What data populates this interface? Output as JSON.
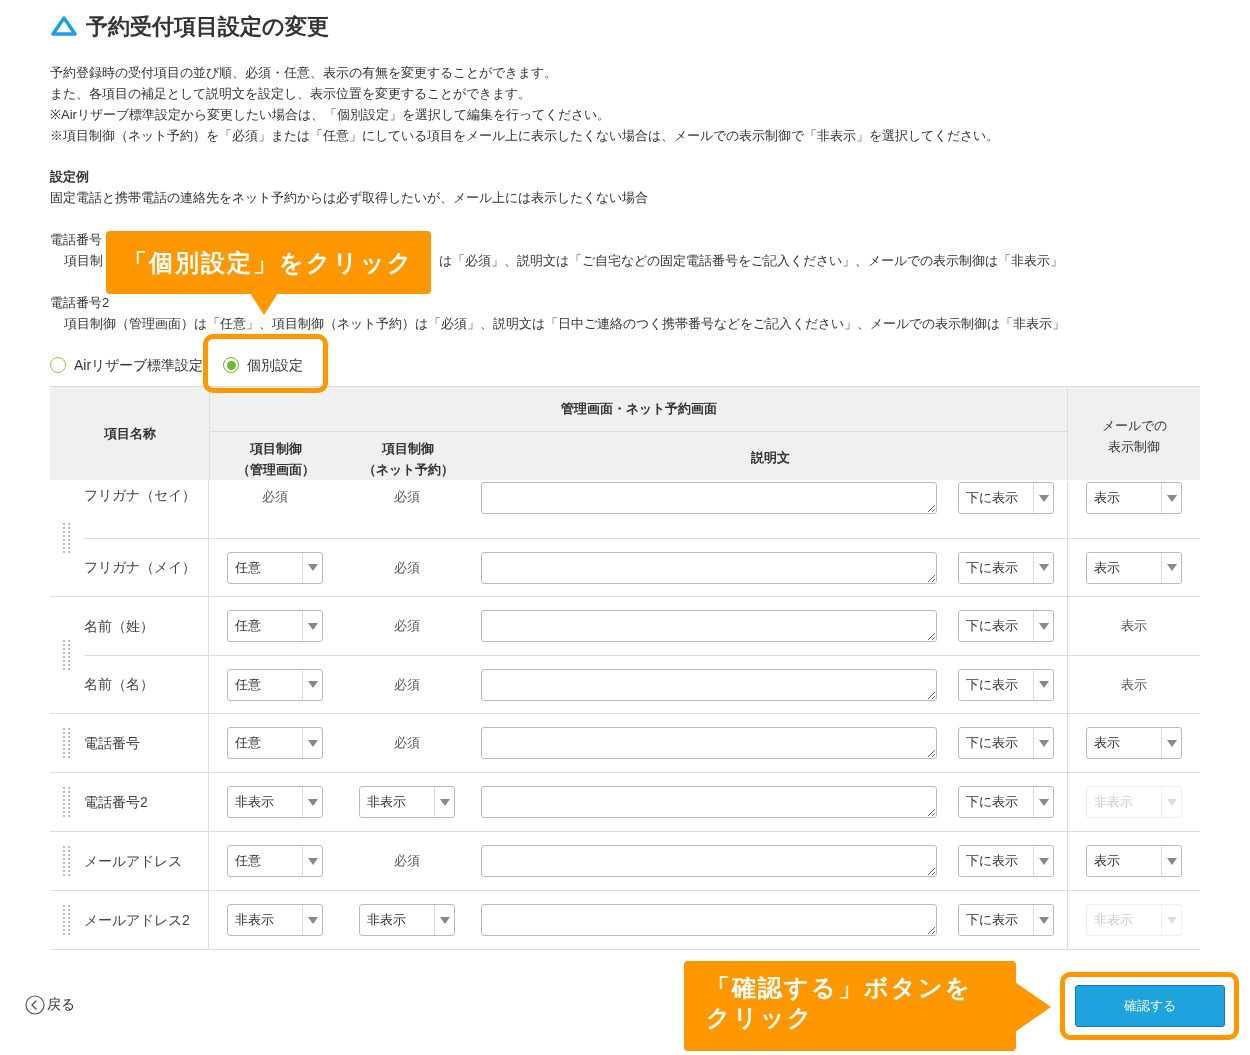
{
  "title": "予約受付項目設定の変更",
  "description": [
    "予約登録時の受付項目の並び順、必須・任意、表示の有無を変更することができます。",
    "また、各項目の補足として説明文を設定し、表示位置を変更することができます。",
    "※Airリザーブ標準設定から変更したい場合は、「個別設定」を選択して編集を行ってください。",
    "※項目制御（ネット予約）を「必須」または「任意」にしている項目をメール上に表示したくない場合は、メールでの表示制御で「非表示」を選択してください。"
  ],
  "example": {
    "heading": "設定例",
    "summary": "固定電話と携帯電話の連絡先をネット予約からは必ず取得したいが、メール上には表示したくない場合",
    "items": [
      {
        "name": "電話番号",
        "detail_left": "項目制",
        "detail_right": "は「必須」、説明文は「ご自宅などの固定電話番号をご記入ください」、メールでの表示制御は「非表示」"
      },
      {
        "name": "電話番号2",
        "detail_left": "項目制御（管理画面）は「任意」、項目制御（ネット予約）は「必須」、説明文は「日中ご連絡のつく携帯番号などをご記入ください」、メールでの表示制御は「非表示」"
      }
    ]
  },
  "radios": [
    {
      "label": "Airリザーブ標準設定",
      "selected": false
    },
    {
      "label": "個別設定",
      "selected": true
    }
  ],
  "callout_top": "「個別設定」をクリック",
  "table": {
    "header_name": "項目名称",
    "header_group": "管理画面・ネット予約画面",
    "header_admin": [
      "項目制御",
      "（管理画面）"
    ],
    "header_net": [
      "項目制御",
      "（ネット予約）"
    ],
    "header_desc": "説明文",
    "header_mail": [
      "メールでの",
      "表示制御"
    ],
    "groups": [
      {
        "rows": [
          {
            "name": "フリガナ（セイ）",
            "admin": {
              "kind": "text",
              "value": "必須"
            },
            "net": {
              "kind": "text",
              "value": "必須"
            },
            "position": "下に表示",
            "mail": {
              "kind": "select",
              "value": "表示",
              "disabled": false
            }
          },
          {
            "name": "フリガナ（メイ）",
            "admin": {
              "kind": "select",
              "value": "任意"
            },
            "net": {
              "kind": "text",
              "value": "必須"
            },
            "position": "下に表示",
            "mail": {
              "kind": "select",
              "value": "表示",
              "disabled": false
            }
          }
        ]
      },
      {
        "rows": [
          {
            "name": "名前（姓）",
            "admin": {
              "kind": "select",
              "value": "任意"
            },
            "net": {
              "kind": "text",
              "value": "必須"
            },
            "position": "下に表示",
            "mail": {
              "kind": "text",
              "value": "表示"
            }
          },
          {
            "name": "名前（名）",
            "admin": {
              "kind": "select",
              "value": "任意"
            },
            "net": {
              "kind": "text",
              "value": "必須"
            },
            "position": "下に表示",
            "mail": {
              "kind": "text",
              "value": "表示"
            }
          }
        ]
      },
      {
        "rows": [
          {
            "name": "電話番号",
            "admin": {
              "kind": "select",
              "value": "任意"
            },
            "net": {
              "kind": "text",
              "value": "必須"
            },
            "position": "下に表示",
            "mail": {
              "kind": "select",
              "value": "表示",
              "disabled": false
            }
          }
        ]
      },
      {
        "rows": [
          {
            "name": "電話番号2",
            "admin": {
              "kind": "select",
              "value": "非表示"
            },
            "net": {
              "kind": "select",
              "value": "非表示"
            },
            "position": "下に表示",
            "mail": {
              "kind": "select",
              "value": "非表示",
              "disabled": true
            }
          }
        ]
      },
      {
        "rows": [
          {
            "name": "メールアドレス",
            "admin": {
              "kind": "select",
              "value": "任意"
            },
            "net": {
              "kind": "text",
              "value": "必須"
            },
            "position": "下に表示",
            "mail": {
              "kind": "select",
              "value": "表示",
              "disabled": false
            }
          }
        ]
      },
      {
        "rows": [
          {
            "name": "メールアドレス2",
            "admin": {
              "kind": "select",
              "value": "非表示"
            },
            "net": {
              "kind": "select",
              "value": "非表示"
            },
            "position": "下に表示",
            "mail": {
              "kind": "select",
              "value": "非表示",
              "disabled": true
            }
          }
        ]
      }
    ]
  },
  "back": "戻る",
  "confirm": "確認する",
  "callout_bottom": [
    "「確認する」ボタンを",
    "クリック"
  ]
}
